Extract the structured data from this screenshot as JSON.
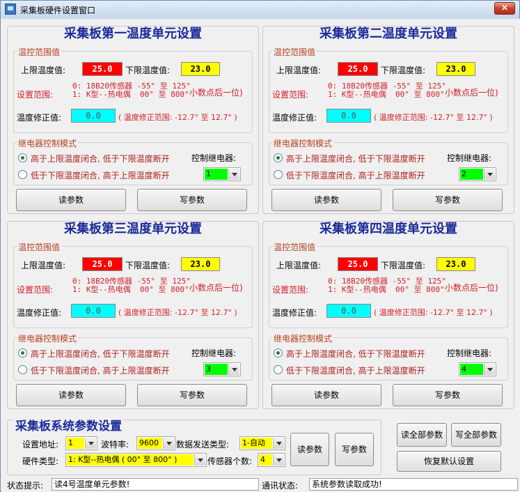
{
  "window": {
    "title": "采集板硬件设置窗口",
    "close": "×"
  },
  "units": [
    {
      "title": "采集板第一温度单元设置",
      "temp_group": "温控范围值",
      "upper_label": "上限温度值:",
      "upper_value": "25.0",
      "lower_label": "下限温度值:",
      "lower_value": "23.0",
      "range_label": "设置范围:",
      "range_line1": "0: 18B20传感器 -55° 至 125°",
      "range_line2": "1: K型--热电偶  00° 至 800°",
      "range_note": "小数点后一位)",
      "corr_label": "温度修正值:",
      "corr_value": "0.0",
      "corr_range": "( 温度修正范围: -12.7° 至 12.7° )",
      "relay_group": "继电器控制模式",
      "opt1": "高于上限温度闭合, 低于下限温度断开",
      "opt2": "低于下限温度闭合, 高于上限温度断开",
      "selected": 1,
      "relay_label": "控制继电器:",
      "relay_value": "1",
      "read_btn": "读参数",
      "write_btn": "写参数"
    },
    {
      "title": "采集板第二温度单元设置",
      "temp_group": "温控范围值",
      "upper_label": "上限温度值:",
      "upper_value": "25.0",
      "lower_label": "下限温度值:",
      "lower_value": "23.0",
      "range_label": "设置范围:",
      "range_line1": "0: 18B20传感器 -55° 至 125°",
      "range_line2": "1: K型--热电偶  00° 至 800°",
      "range_note": "小数点后一位)",
      "corr_label": "温度修正值:",
      "corr_value": "0.0",
      "corr_range": "( 温度修正范围: -12.7° 至 12.7° )",
      "relay_group": "继电器控制模式",
      "opt1": "高于上限温度闭合, 低于下限温度断开",
      "opt2": "低于下限温度闭合, 高于上限温度断开",
      "selected": 1,
      "relay_label": "控制继电器:",
      "relay_value": "2",
      "read_btn": "读参数",
      "write_btn": "写参数"
    },
    {
      "title": "采集板第三温度单元设置",
      "temp_group": "温控范围值",
      "upper_label": "上限温度值:",
      "upper_value": "25.0",
      "lower_label": "下限温度值:",
      "lower_value": "23.0",
      "range_label": "设置范围:",
      "range_line1": "0: 18B20传感器 -55° 至 125°",
      "range_line2": "1: K型--热电偶  00° 至 800°",
      "range_note": "小数点后一位)",
      "corr_label": "温度修正值:",
      "corr_value": "0.0",
      "corr_range": "( 温度修正范围: -12.7° 至 12.7° )",
      "relay_group": "继电器控制模式",
      "opt1": "高于上限温度闭合, 低于下限温度断开",
      "opt2": "低于下限温度闭合, 高于上限温度断开",
      "selected": 1,
      "relay_label": "控制继电器:",
      "relay_value": "3",
      "read_btn": "读参数",
      "write_btn": "写参数"
    },
    {
      "title": "采集板第四温度单元设置",
      "temp_group": "温控范围值",
      "upper_label": "上限温度值:",
      "upper_value": "25.0",
      "lower_label": "下限温度值:",
      "lower_value": "23.0",
      "range_label": "设置范围:",
      "range_line1": "0: 18B20传感器 -55° 至 125°",
      "range_line2": "1: K型--热电偶  00° 至 800°",
      "range_note": "小数点后一位)",
      "corr_label": "温度修正值:",
      "corr_value": "0.0",
      "corr_range": "( 温度修正范围: -12.7° 至 12.7° )",
      "relay_group": "继电器控制模式",
      "opt1": "高于上限温度闭合, 低于下限温度断开",
      "opt2": "低于下限温度闭合, 高于上限温度断开",
      "selected": 1,
      "relay_label": "控制继电器:",
      "relay_value": "4",
      "read_btn": "读参数",
      "write_btn": "写参数"
    }
  ],
  "system": {
    "title": "采集板系统参数设置",
    "addr_label": "设置地址:",
    "addr_value": "1",
    "baud_label": "波特率:",
    "baud_value": "9600",
    "send_label": "数据发送类型:",
    "send_value": "1-自动",
    "hw_label": "硬件类型:",
    "hw_value": "1: K型--热电偶 ( 00° 至 800° )",
    "sensor_label": "传感器个数:",
    "sensor_value": "4",
    "read_btn": "读参数",
    "write_btn": "写参数",
    "read_all": "读全部参数",
    "write_all": "写全部参数",
    "restore": "恢复默认设置"
  },
  "status": {
    "hint_label": "状态提示:",
    "hint_value": "读4号温度单元参数!",
    "comm_label": "通讯状态:",
    "comm_value": "系统参数读取成功!"
  }
}
